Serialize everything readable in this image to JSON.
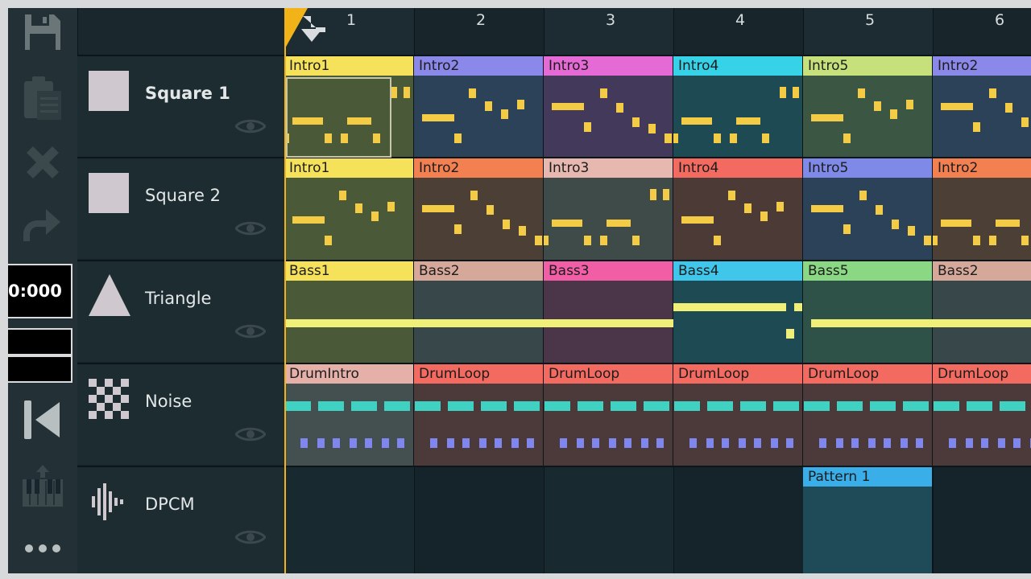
{
  "time_display": "0:000",
  "colors": {
    "background": "#17262d",
    "accent": "#f2b318",
    "note_square": "#f3cb45",
    "note_triangle": "#f0f079",
    "note_noise_a": "#3fd1c2",
    "note_noise_b": "#7f86ee"
  },
  "toolbar": {
    "items": [
      {
        "name": "save-icon"
      },
      {
        "name": "paste-icon"
      },
      {
        "name": "delete-icon"
      },
      {
        "name": "redo-icon"
      },
      {
        "name": "rewind-icon"
      },
      {
        "name": "piano-icon"
      },
      {
        "name": "more-icon"
      }
    ]
  },
  "columns": [
    "1",
    "2",
    "3",
    "4",
    "5",
    "6"
  ],
  "channels": [
    {
      "name": "Square 1",
      "icon": "square-wave-icon"
    },
    {
      "name": "Square 2",
      "icon": "square-wave-icon"
    },
    {
      "name": "Triangle",
      "icon": "triangle-wave-icon"
    },
    {
      "name": "Noise",
      "icon": "noise-icon"
    },
    {
      "name": "DPCM",
      "icon": "dpcm-waveform-icon"
    }
  ],
  "patterns": {
    "square1": [
      {
        "label": "Intro1",
        "head": "#f6e25a",
        "body": "#4a5a38"
      },
      {
        "label": "Intro2",
        "head": "#8a88e8",
        "body": "#2c4258"
      },
      {
        "label": "Intro3",
        "head": "#e66ad6",
        "body": "#43395a"
      },
      {
        "label": "Intro4",
        "head": "#36d2e8",
        "body": "#1e4a53"
      },
      {
        "label": "Intro5",
        "head": "#c6e07c",
        "body": "#3c5644"
      },
      {
        "label": "Intro2",
        "head": "#8a88e8",
        "body": "#2c4258"
      }
    ],
    "square2": [
      {
        "label": "Intro1",
        "head": "#f6e25a",
        "body": "#4a5a38"
      },
      {
        "label": "Intro2",
        "head": "#f28050",
        "body": "#4c3f36"
      },
      {
        "label": "Intro3",
        "head": "#e6b8b0",
        "body": "#3f4b49"
      },
      {
        "label": "Intro4",
        "head": "#f26a60",
        "body": "#4c3a36"
      },
      {
        "label": "Intro5",
        "head": "#7f8ae8",
        "body": "#2c4258"
      },
      {
        "label": "Intro2",
        "head": "#f28050",
        "body": "#4c3f36"
      }
    ],
    "triangle": [
      {
        "label": "Bass1",
        "head": "#f6e25a",
        "body": "#4a5a38"
      },
      {
        "label": "Bass2",
        "head": "#d6a89a",
        "body": "#38484a"
      },
      {
        "label": "Bass3",
        "head": "#f25ea6",
        "body": "#4a3549"
      },
      {
        "label": "Bass4",
        "head": "#40c6ea",
        "body": "#1e4a53"
      },
      {
        "label": "Bass5",
        "head": "#8ad884",
        "body": "#2e5248"
      },
      {
        "label": "Bass2",
        "head": "#d6a89a",
        "body": "#38484a"
      }
    ],
    "noise": [
      {
        "label": "DrumIntro",
        "head": "#e4b0a8",
        "body": "#44504f"
      },
      {
        "label": "DrumLoop",
        "head": "#f26a60",
        "body": "#4c3a3a"
      },
      {
        "label": "DrumLoop",
        "head": "#f26a60",
        "body": "#4c3a3a"
      },
      {
        "label": "DrumLoop",
        "head": "#f26a60",
        "body": "#4c3a3a"
      },
      {
        "label": "DrumLoop",
        "head": "#f26a60",
        "body": "#4c3a3a"
      },
      {
        "label": "DrumLoop",
        "head": "#f26a60",
        "body": "#4c3a3a"
      }
    ],
    "dpcm": [
      {
        "label": "Pattern 1",
        "head": "#3aaee8",
        "body": "#1f4a57"
      }
    ]
  }
}
